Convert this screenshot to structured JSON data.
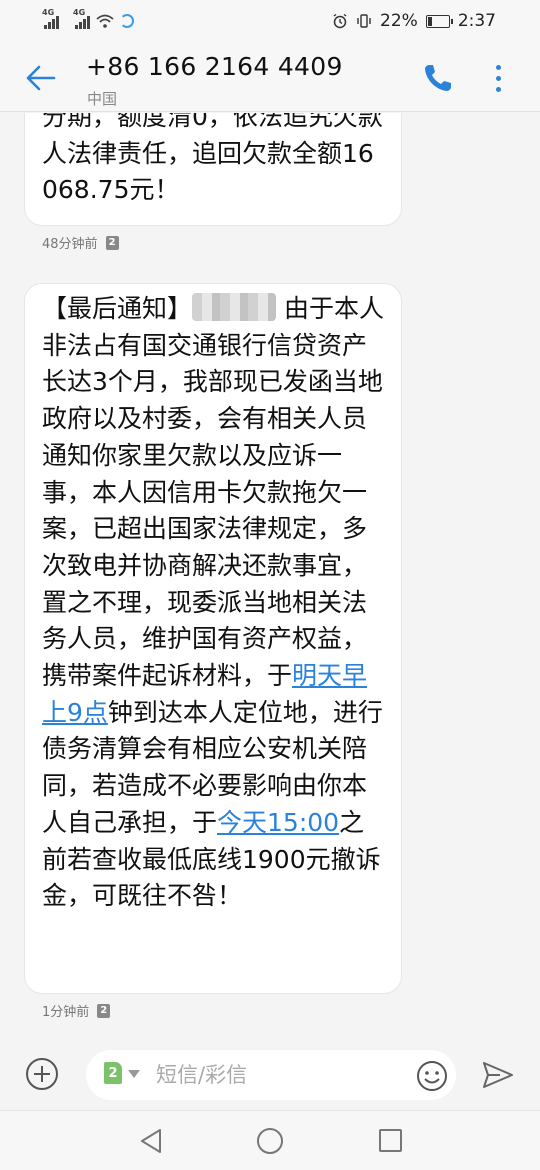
{
  "status_bar": {
    "net_1": "4G",
    "net_2": "4G",
    "battery_percent": "22%",
    "battery_level": 0.22,
    "time": "2:37"
  },
  "header": {
    "title": "+86 166 2164 4409",
    "subtitle": "中国"
  },
  "messages": [
    {
      "text": "分期，额度清0，依法追究欠款人法律责任，追回欠款全额16068.75元！",
      "time": "48分钟前",
      "sim": "2"
    },
    {
      "part1": "【最后通知】",
      "part2": " 由于本人非法占有国交通银行信贷资产长达3个月，我部现已发函当地政府以及村委，会有相关人员通知你家里欠款以及应诉一事，本人因信用卡欠款拖欠一案，已超出国家法律规定，多次致电并协商解决还款事宜，置之不理，现委派当地相关法务人员，维护国有资产权益，携带案件起诉材料，于",
      "link1": "明天早上9点",
      "part3": "钟到达本人定位地，进行债务清算会有相应公安机关陪同，若造成不必要影响由你本人自己承担，于",
      "link2": "今天15:00",
      "part4": "之前若查收最低底线1900元撤诉金，可既往不咎！",
      "time": "1分钟前",
      "sim": "2"
    }
  ],
  "composer": {
    "sim": "2",
    "placeholder": "短信/彩信"
  },
  "colors": {
    "accent": "#2b82d9",
    "sim_green": "#7cc26b"
  }
}
